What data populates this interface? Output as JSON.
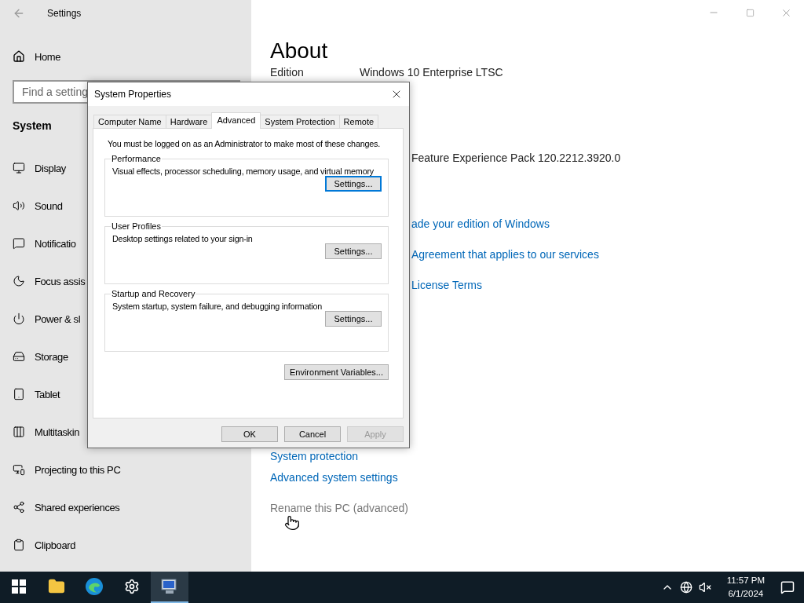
{
  "settings_window": {
    "title": "Settings",
    "home": "Home",
    "search": {
      "placeholder": "Find a setting"
    },
    "section": "System",
    "nav": [
      {
        "label": "Display"
      },
      {
        "label": "Sound"
      },
      {
        "label": "Notificatio"
      },
      {
        "label": "Focus assis"
      },
      {
        "label": "Power & sl"
      },
      {
        "label": "Storage"
      },
      {
        "label": "Tablet"
      },
      {
        "label": "Multitaskin"
      },
      {
        "label": "Projecting to this PC"
      },
      {
        "label": "Shared experiences"
      },
      {
        "label": "Clipboard"
      }
    ]
  },
  "about": {
    "heading": "About",
    "specs": [
      {
        "label": "Edition",
        "value": "Windows 10 Enterprise LTSC"
      }
    ],
    "spec_fragment": "Feature Experience Pack 120.2212.3920.0",
    "link_fragments": [
      "ade your edition of Windows",
      "Agreement that applies to our services",
      "License Terms"
    ],
    "related": [
      {
        "label": "System protection",
        "disabled": false
      },
      {
        "label": "Advanced system settings",
        "disabled": false
      },
      {
        "label": "Rename this PC (advanced)",
        "disabled": true
      }
    ]
  },
  "dialog": {
    "title": "System Properties",
    "tabs": [
      {
        "label": "Computer Name",
        "selected": false
      },
      {
        "label": "Hardware",
        "selected": false
      },
      {
        "label": "Advanced",
        "selected": true
      },
      {
        "label": "System Protection",
        "selected": false
      },
      {
        "label": "Remote",
        "selected": false
      }
    ],
    "notice": "You must be logged on as an Administrator to make most of these changes.",
    "groups": [
      {
        "title": "Performance",
        "description": "Visual effects, processor scheduling, memory usage, and virtual memory",
        "button": {
          "label": "Settings...",
          "focused": true
        }
      },
      {
        "title": "User Profiles",
        "description": "Desktop settings related to your sign-in",
        "button": {
          "label": "Settings...",
          "focused": false
        }
      },
      {
        "title": "Startup and Recovery",
        "description": "System startup, system failure, and debugging information",
        "button": {
          "label": "Settings...",
          "focused": false
        }
      }
    ],
    "env_button": "Environment Variables...",
    "footer": [
      {
        "label": "OK",
        "disabled": false
      },
      {
        "label": "Cancel",
        "disabled": false
      },
      {
        "label": "Apply",
        "disabled": true
      }
    ]
  },
  "taskbar": {
    "apps": [
      {
        "active": false
      },
      {
        "active": false
      },
      {
        "active": false
      },
      {
        "active": true
      }
    ],
    "time": "11:57 PM",
    "date": "6/1/2024"
  }
}
